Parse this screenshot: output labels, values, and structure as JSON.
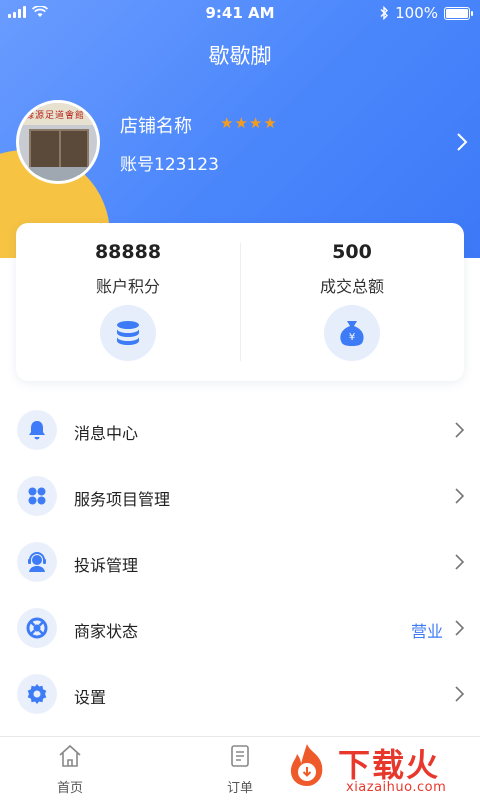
{
  "status_bar": {
    "time": "9:41 AM",
    "battery": "100%"
  },
  "app": {
    "title": "歇歇脚"
  },
  "shop": {
    "sign_text": "緑源足道會館",
    "name": "店铺名称",
    "rating_stars": "★★★★",
    "rating": 4,
    "account": "账号123123"
  },
  "stats": [
    {
      "value": "88888",
      "label": "账户积分",
      "icon": "coins-icon"
    },
    {
      "value": "500",
      "label": "成交总额",
      "icon": "money-bag-icon"
    }
  ],
  "menu": [
    {
      "label": "消息中心",
      "icon": "bell-icon",
      "value": ""
    },
    {
      "label": "服务项目管理",
      "icon": "grid-icon",
      "value": ""
    },
    {
      "label": "投诉管理",
      "icon": "support-agent-icon",
      "value": ""
    },
    {
      "label": "商家状态",
      "icon": "lifebuoy-icon",
      "value": "营业"
    },
    {
      "label": "设置",
      "icon": "gear-icon",
      "value": ""
    }
  ],
  "tabbar": [
    {
      "label": "首页",
      "icon": "home-icon"
    },
    {
      "label": "订单",
      "icon": "orders-icon"
    }
  ],
  "watermark": {
    "title": "下载火",
    "domain": "xiazaihuo.com"
  },
  "colors": {
    "primary": "#4a86fb",
    "accent": "#f6c342",
    "star": "#f39c1f",
    "watermark": "#e8382c"
  }
}
